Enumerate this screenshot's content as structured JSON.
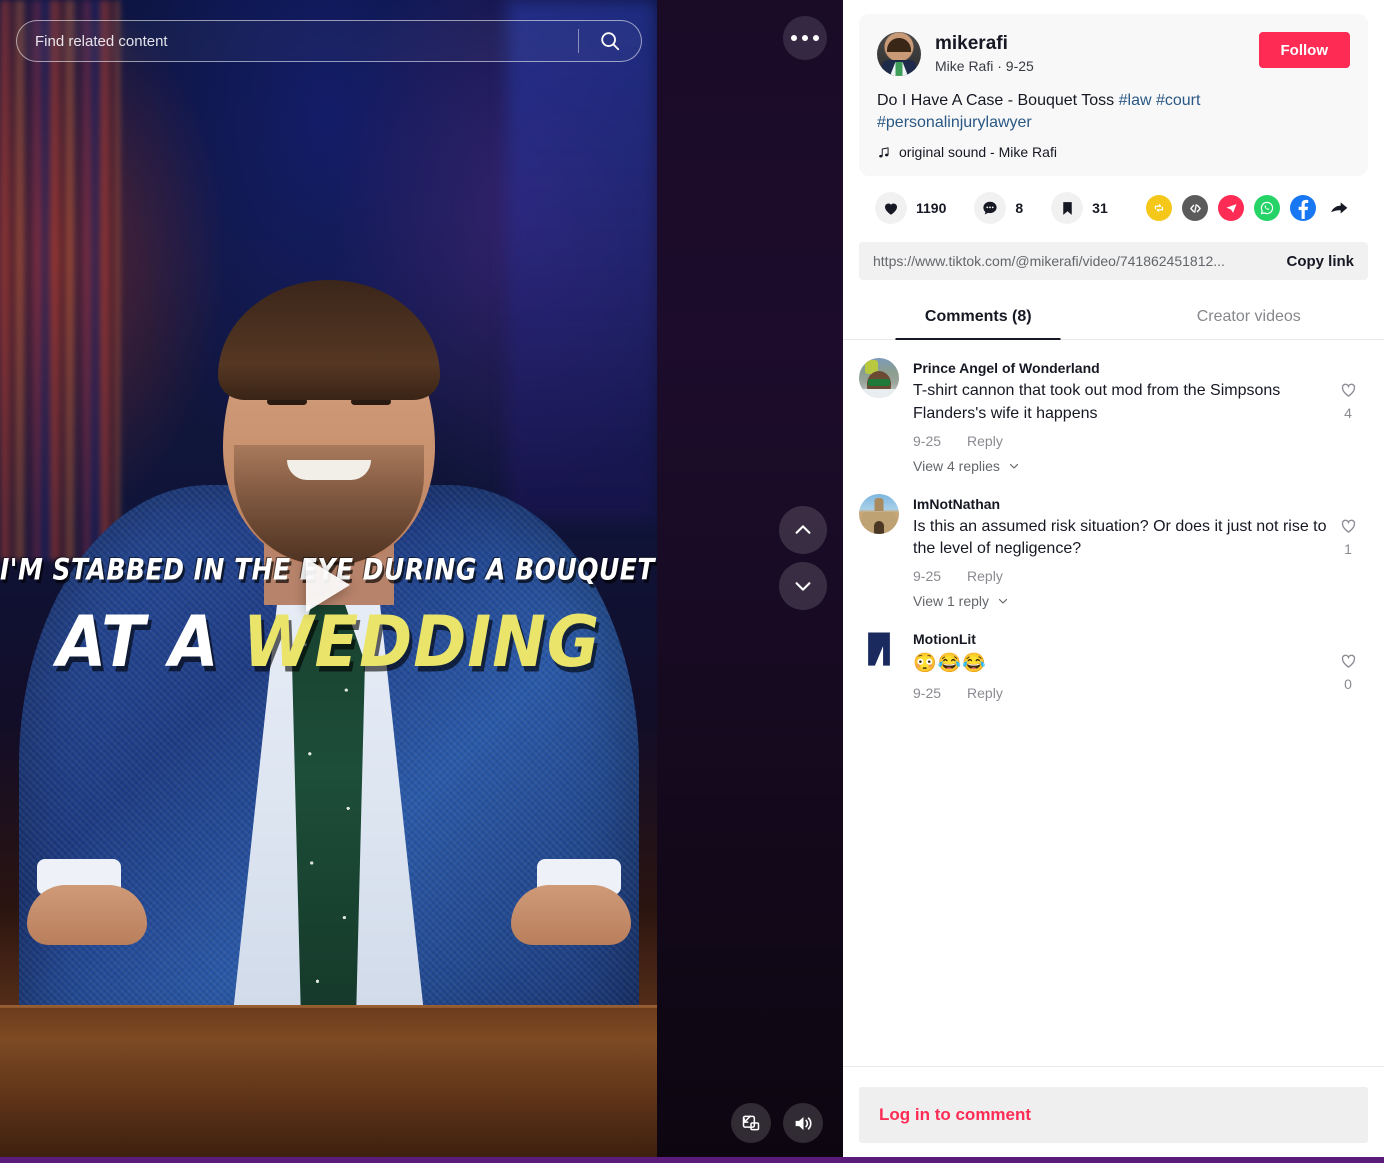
{
  "video": {
    "search": {
      "placeholder": "Find related content",
      "value": "",
      "icon": "search-icon"
    },
    "more_icon": "more-options-icon",
    "nav_up_icon": "chevron-up-icon",
    "nav_down_icon": "chevron-down-icon",
    "pip_icon": "picture-in-picture-icon",
    "volume_icon": "volume-on-icon",
    "play_icon": "play-icon",
    "caption_line1": "I'M STABBED IN THE EYE DURING A BOUQUET TOSS",
    "caption_line2_white": "AT A ",
    "caption_line2_yellow": "WEDDING",
    "caption_highlight_color": "#eae46a"
  },
  "post": {
    "username": "mikerafi",
    "nickname_and_date": "Mike Rafi · 9-25",
    "follow_label": "Follow",
    "follow_color": "#fe2c55",
    "description": "Do I Have A Case - Bouquet Toss ",
    "hashtags": [
      "#law",
      "#court",
      "#personalinjurylawyer"
    ],
    "hashtag_color": "#2a5885",
    "music_icon": "music-note-icon",
    "music_label": "original sound - Mike Rafi"
  },
  "actions": {
    "like": {
      "icon": "heart-icon",
      "count": "1190"
    },
    "comment": {
      "icon": "comment-icon",
      "count": "8"
    },
    "bookmark": {
      "icon": "bookmark-icon",
      "count": "31"
    },
    "share_icons": [
      {
        "name": "repost-icon",
        "color": "#f5c718"
      },
      {
        "name": "embed-code-icon",
        "color": "#5b5b5b"
      },
      {
        "name": "telegram-icon",
        "color": "#fe2c55"
      },
      {
        "name": "whatsapp-icon",
        "color": "#25d366"
      },
      {
        "name": "facebook-icon",
        "color": "#1877f2"
      },
      {
        "name": "share-arrow-icon",
        "color": "#161823"
      }
    ]
  },
  "copy_link": {
    "url": "https://www.tiktok.com/@mikerafi/video/741862451812...",
    "button_label": "Copy link"
  },
  "tabs": [
    {
      "label": "Comments (8)",
      "active": true
    },
    {
      "label": "Creator videos",
      "active": false
    }
  ],
  "comments": [
    {
      "avatar": "av-prince",
      "name": "Prince Angel of Wonderland",
      "text": "T-shirt cannon that took out mod from the Simpsons Flanders's wife it happens",
      "date": "9-25",
      "reply_label": "Reply",
      "replies_label": "View 4 replies",
      "likes": "4"
    },
    {
      "avatar": "av-nathan",
      "name": "ImNotNathan",
      "text": "Is this an assumed risk situation? Or does it just not rise to the level of negligence?",
      "date": "9-25",
      "reply_label": "Reply",
      "replies_label": "View 1 reply",
      "likes": "1"
    },
    {
      "avatar": "av-motionlit",
      "name": "MotionLit",
      "text": "😳😂😂",
      "date": "9-25",
      "reply_label": "Reply",
      "replies_label": "",
      "likes": "0"
    }
  ],
  "footer": {
    "login_label": "Log in to comment",
    "login_color": "#fe2c55"
  }
}
